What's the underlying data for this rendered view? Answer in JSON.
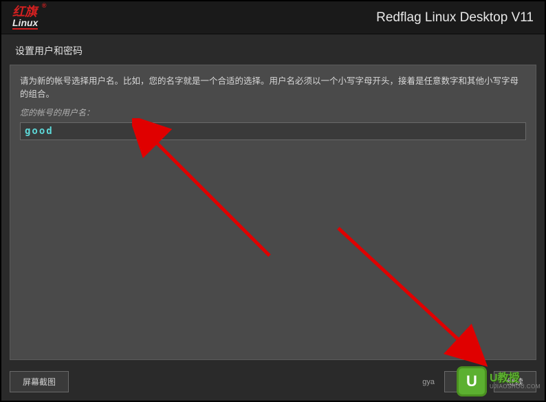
{
  "header": {
    "logo_cn": "红旗",
    "logo_en": "Linux",
    "title": "Redflag Linux Desktop V11"
  },
  "section": {
    "title": "设置用户和密码"
  },
  "form": {
    "instruction": "请为新的帐号选择用户名。比如，您的名字就是一个合适的选择。用户名必须以一个小写字母开头，接着是任意数字和其他小写字母的组合。",
    "field_label": "您的帐号的用户名：",
    "username_value": "good"
  },
  "footer": {
    "screenshot_btn": "屏幕截图",
    "help_text": "gya",
    "back_btn": "返回",
    "continue_btn": "继续"
  },
  "watermark": {
    "brand": "U教授",
    "url": "UJIAOSHOU.COM"
  }
}
